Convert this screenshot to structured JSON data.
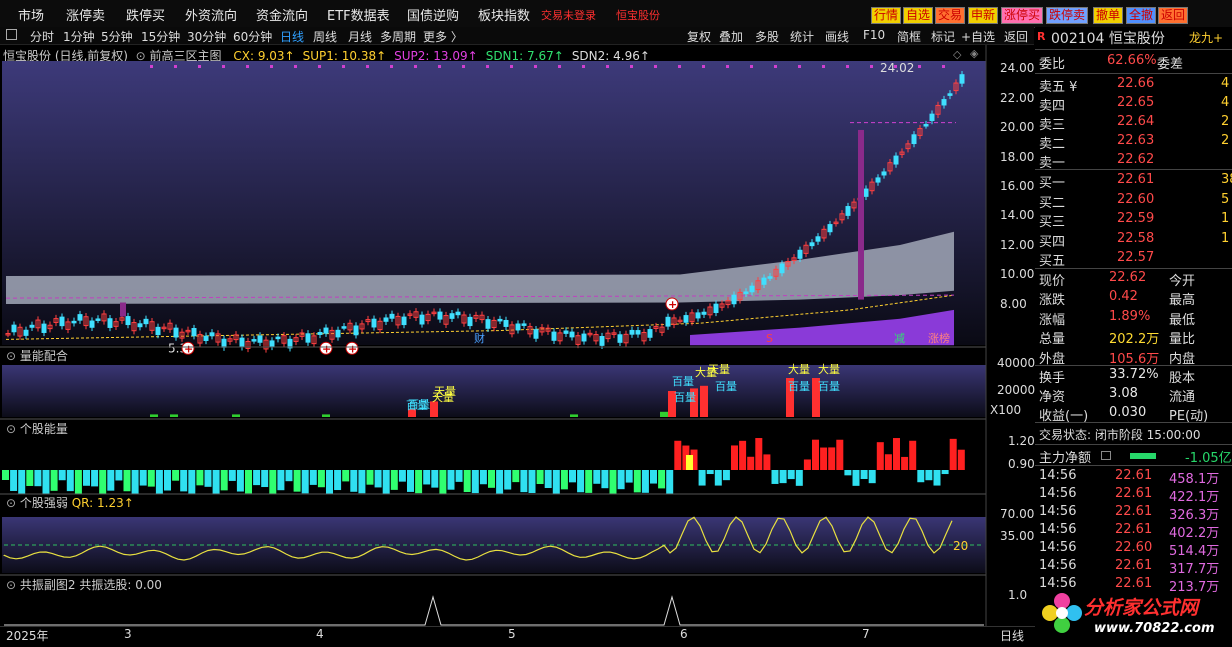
{
  "menu": [
    "市场",
    "涨停卖",
    "跌停买",
    "外资流向",
    "资金流向",
    "ETF数据表",
    "国债逆购",
    "板块指数"
  ],
  "login_status": "交易未登录",
  "menu_stock": "恒宝股份",
  "right_buttons": [
    {
      "label": "行情",
      "color": "#f0d000"
    },
    {
      "label": "自选",
      "color": "#f0d000"
    },
    {
      "label": "交易",
      "color": "#ff7030"
    },
    {
      "label": "申新",
      "color": "#f0d000"
    },
    {
      "label": "涨停买",
      "color": "#ff70b0"
    },
    {
      "label": "跌停卖",
      "color": "#70a0ff"
    },
    {
      "label": "撤单",
      "color": "#f0d000"
    },
    {
      "label": "全撤",
      "color": "#5090ff"
    },
    {
      "label": "返回",
      "color": "#ff7030"
    }
  ],
  "periods": [
    "分时",
    "1分钟",
    "5分钟",
    "15分钟",
    "30分钟",
    "60分钟",
    "日线",
    "周线",
    "月线",
    "多周期",
    "更多 〉"
  ],
  "active_period": "日线",
  "tools": [
    "复权",
    "叠加",
    "多股",
    "统计",
    "画线",
    "F10",
    "简框",
    "标记",
    "+自选",
    "返回"
  ],
  "main": {
    "stock_title": "恒宝股份 (日线,前复权)",
    "indicator_name": "前高三区主图",
    "indicators": [
      {
        "label": "CX: 9.03↑",
        "color": "#ffd030"
      },
      {
        "label": "SUP1: 10.38↑",
        "color": "#ffd030"
      },
      {
        "label": "SUP2: 13.09↑",
        "color": "#e040e0"
      },
      {
        "label": "SDN1: 7.67↑",
        "color": "#30e070"
      },
      {
        "label": "SDN2: 4.96↑",
        "color": "#dddddd"
      }
    ],
    "price_axis": [
      "24.00",
      "22.00",
      "20.00",
      "18.00",
      "16.00",
      "14.00",
      "12.00",
      "10.00",
      "8.00"
    ],
    "high_label": "24.02",
    "low_label": "5.39",
    "markers": {
      "cai": "财",
      "s": "S",
      "jian": "减",
      "zhangbang": "涨榜"
    }
  },
  "panel_volume": {
    "label": "量能配合",
    "axis": [
      "40000",
      "20000"
    ],
    "unit": "X100",
    "tags": [
      "天量",
      "百量",
      "天量",
      "百量",
      "大量",
      "百量",
      "百量",
      "天量",
      "百量",
      "大量",
      "百量"
    ]
  },
  "panel_energy": {
    "label": "个股能量",
    "axis": [
      "1.20",
      "0.90"
    ]
  },
  "panel_strength": {
    "label": "个股强弱",
    "value": "QR: 1.23↑",
    "axis": [
      "70.00",
      "35.00"
    ],
    "level": "20"
  },
  "panel_resonance": {
    "label": "共振副图2",
    "value": "共振选股: 0.00",
    "axis": [
      "1.0"
    ]
  },
  "xaxis": [
    "2025年",
    "3",
    "4",
    "5",
    "6",
    "7",
    "日线"
  ],
  "quote": {
    "code": "002104",
    "name": "恒宝股份",
    "tag": "龙九+",
    "weibi_label": "委比",
    "weibi": "62.66%",
    "weicha_label": "委差",
    "asks": [
      {
        "label": "卖五 ¥",
        "price": "22.66",
        "vol": "4"
      },
      {
        "label": "卖四",
        "price": "22.65",
        "vol": "4"
      },
      {
        "label": "卖三",
        "price": "22.64",
        "vol": "2"
      },
      {
        "label": "卖二",
        "price": "22.63",
        "vol": "2"
      },
      {
        "label": "卖一",
        "price": "22.62",
        "vol": ""
      }
    ],
    "bids": [
      {
        "label": "买一",
        "price": "22.61",
        "vol": "38"
      },
      {
        "label": "买二",
        "price": "22.60",
        "vol": "5"
      },
      {
        "label": "买三",
        "price": "22.59",
        "vol": "1"
      },
      {
        "label": "买四",
        "price": "22.58",
        "vol": "1"
      },
      {
        "label": "买五",
        "price": "22.57",
        "vol": ""
      }
    ],
    "stats": [
      {
        "l1": "现价",
        "v1": "22.62",
        "c1": "#ff4a4a",
        "l2": "今开"
      },
      {
        "l1": "涨跌",
        "v1": "0.42",
        "c1": "#ff4a4a",
        "l2": "最高"
      },
      {
        "l1": "涨幅",
        "v1": "1.89%",
        "c1": "#ff4a4a",
        "l2": "最低"
      },
      {
        "l1": "总量",
        "v1": "202.2万",
        "c1": "#ffdb32",
        "l2": "量比"
      },
      {
        "l1": "外盘",
        "v1": "105.6万",
        "c1": "#ff4a4a",
        "l2": "内盘"
      },
      {
        "l1": "换手",
        "v1": "33.72%",
        "c1": "#e8e8e8",
        "l2": "股本"
      },
      {
        "l1": "净资",
        "v1": "3.08",
        "c1": "#e8e8e8",
        "l2": "流通"
      },
      {
        "l1": "收益(一)",
        "v1": "0.030",
        "c1": "#e8e8e8",
        "l2": "PE(动)"
      }
    ],
    "trade_status": "交易状态: 闭市阶段 15:00:00",
    "main_net_label": "主力净额",
    "main_net_value": "-1.05亿",
    "ticks": [
      {
        "t": "14:56",
        "p": "22.61",
        "v": "458.1万"
      },
      {
        "t": "14:56",
        "p": "22.61",
        "v": "422.1万"
      },
      {
        "t": "14:56",
        "p": "22.61",
        "v": "326.3万"
      },
      {
        "t": "14:56",
        "p": "22.61",
        "v": "402.2万"
      },
      {
        "t": "14:56",
        "p": "22.60",
        "v": "514.4万"
      },
      {
        "t": "14:56",
        "p": "22.61",
        "v": "317.7万"
      },
      {
        "t": "14:56",
        "p": "22.61",
        "v": "213.7万"
      }
    ]
  },
  "watermark": {
    "title": "分析家公式网",
    "url": "www.70822.com"
  }
}
